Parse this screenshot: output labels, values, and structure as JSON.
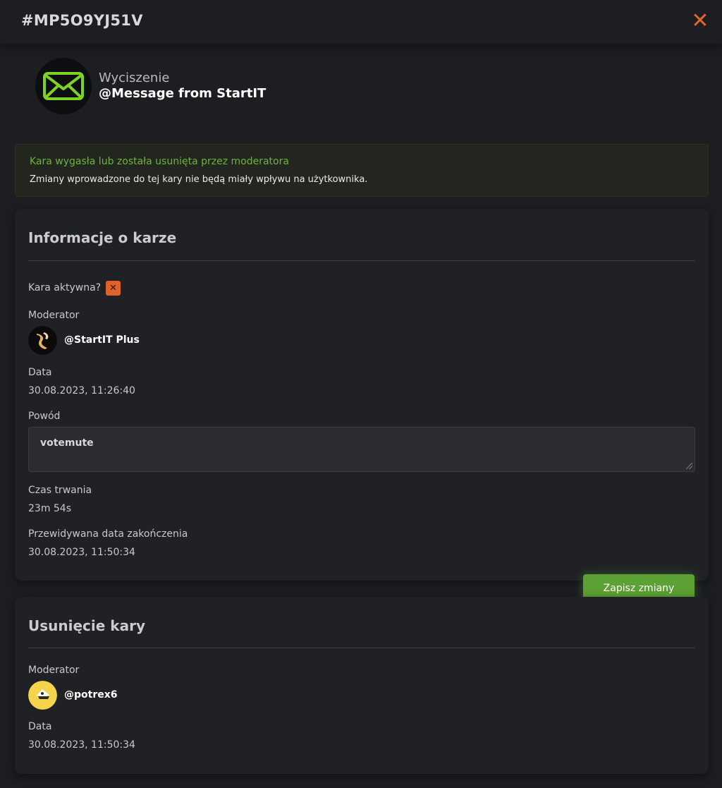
{
  "header": {
    "case_id": "#MP5O9YJ51V",
    "close_symbol": "✕"
  },
  "punishment": {
    "type": "Wyciszenie",
    "target": "@Message from StartIT",
    "icon": "envelope-icon"
  },
  "alert": {
    "title": "Kara wygasła lub została usunięta przez moderatora",
    "text": "Zmiany wprowadzone do tej kary nie będą miały wpływu na użytkownika."
  },
  "info": {
    "title": "Informacje o karze",
    "active_label": "Kara aktywna?",
    "active_symbol": "✕",
    "moderator_label": "Moderator",
    "moderator_name": "@StartIT Plus",
    "date_label": "Data",
    "date_value": "30.08.2023, 11:26:40",
    "reason_label": "Powód",
    "reason_value": "votemute",
    "duration_label": "Czas trwania",
    "duration_value": "23m 54s",
    "end_label": "Przewidywana data zakończenia",
    "end_value": "30.08.2023, 11:50:34"
  },
  "save_button": "Zapisz zmiany",
  "removal": {
    "title": "Usunięcie kary",
    "moderator_label": "Moderator",
    "moderator_name": "@potrex6",
    "date_label": "Data",
    "date_value": "30.08.2023, 11:50:34"
  },
  "colors": {
    "accent_green": "#5ca134",
    "alert_green": "#6cb33f",
    "close_orange": "#e4662b",
    "background": "#1c1e22"
  }
}
